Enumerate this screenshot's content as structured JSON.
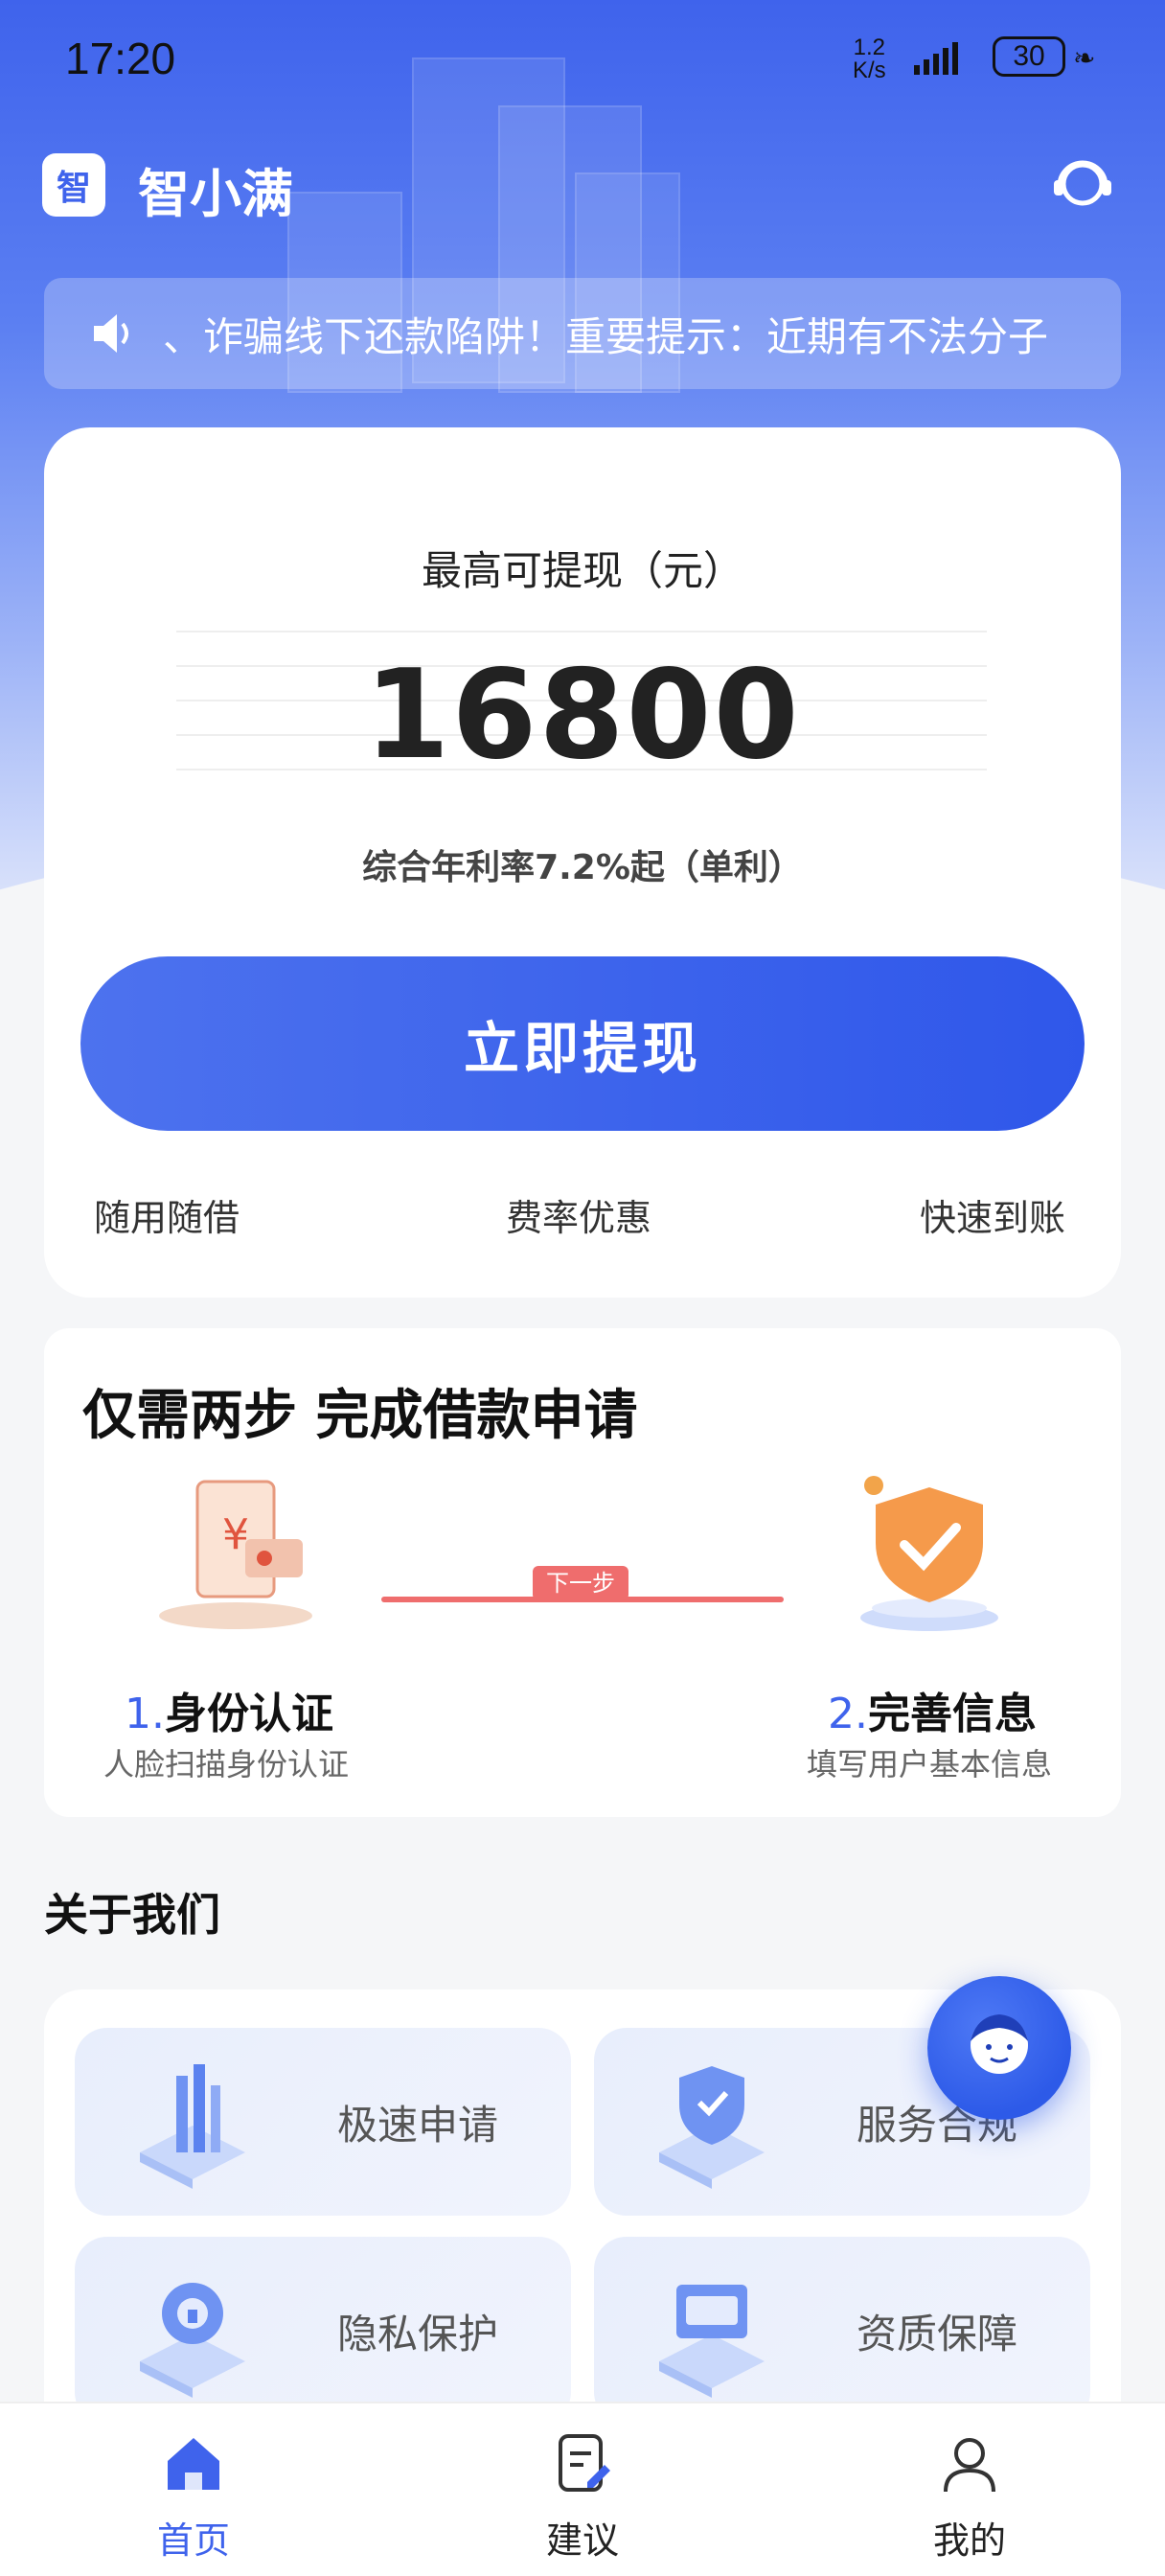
{
  "status_bar": {
    "time": "17:20",
    "net_speed_value": "1.2",
    "net_speed_unit": "K/s",
    "battery": "30"
  },
  "header": {
    "app_name": "智小满",
    "logo_char": "智"
  },
  "notice": {
    "text": "、诈骗线下还款陷阱！重要提示：近期有不法分子"
  },
  "loan_card": {
    "label": "最高可提现（元）",
    "amount": "16800",
    "rate": "综合年利率7.2%起（单利）",
    "button": "立即提现",
    "features": [
      "随用随借",
      "费率优惠",
      "快速到账"
    ]
  },
  "steps": {
    "title": "仅需两步 完成借款申请",
    "next_tag": "下一步",
    "items": [
      {
        "num": "1.",
        "title": "身份认证",
        "subtitle": "人脸扫描身份认证"
      },
      {
        "num": "2.",
        "title": "完善信息",
        "subtitle": "填写用户基本信息"
      }
    ]
  },
  "about": {
    "title": "关于我们",
    "items": [
      {
        "label": "极速申请",
        "icon": "speed-apply-icon"
      },
      {
        "label": "服务合规",
        "icon": "compliance-shield-icon"
      },
      {
        "label": "隐私保护",
        "icon": "privacy-lock-icon"
      },
      {
        "label": "资质保障",
        "icon": "qualification-card-icon"
      }
    ]
  },
  "tabbar": {
    "items": [
      {
        "label": "首页",
        "icon": "home-icon",
        "active": true
      },
      {
        "label": "建议",
        "icon": "feedback-icon",
        "active": false
      },
      {
        "label": "我的",
        "icon": "profile-icon",
        "active": false
      }
    ]
  },
  "colors": {
    "primary": "#3f63ec",
    "accent_red": "#ef6d6d",
    "background": "#f5f6f8"
  }
}
